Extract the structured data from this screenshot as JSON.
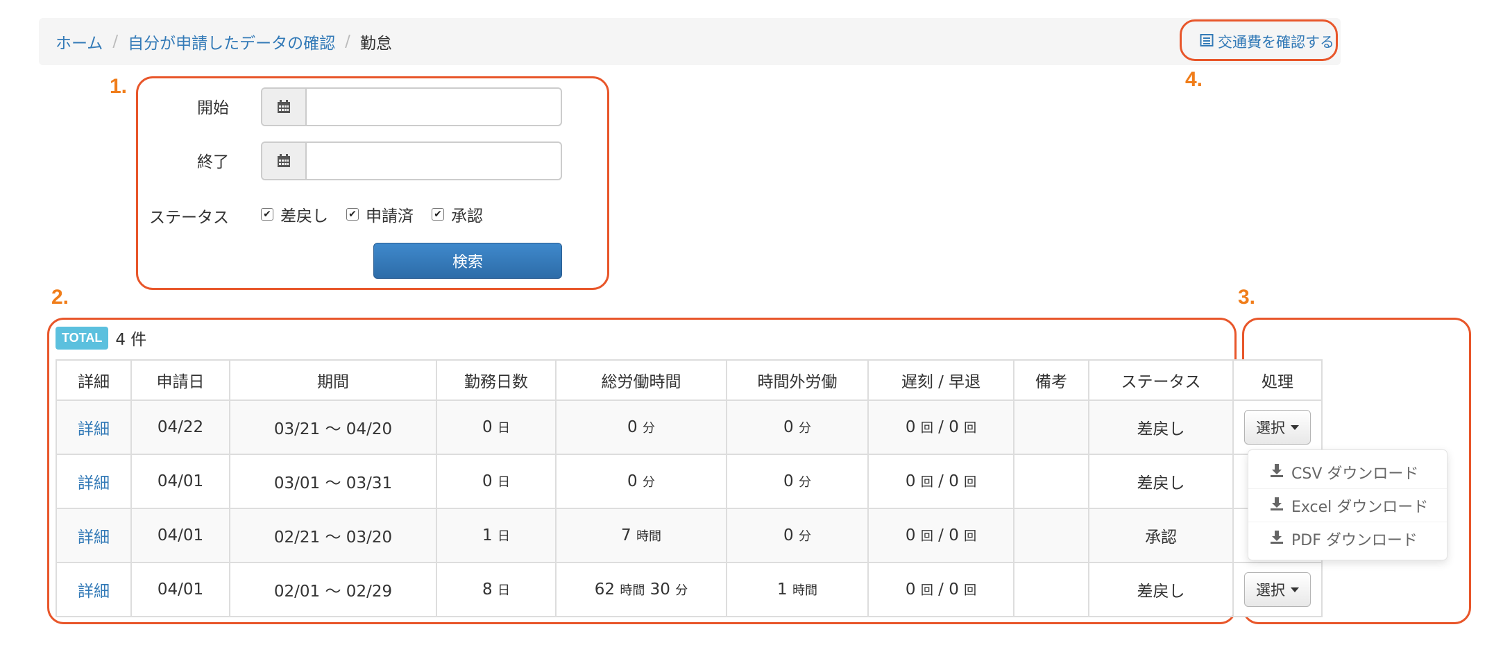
{
  "breadcrumb": {
    "home": "ホーム",
    "sep": "/",
    "requested": "自分が申請したデータの確認",
    "current": "勤怠"
  },
  "transport_link": {
    "label": "交通費を確認する",
    "icon": "list-icon"
  },
  "callouts": {
    "one": "1.",
    "two": "2.",
    "three": "3.",
    "four": "4."
  },
  "form": {
    "start_label": "開始",
    "end_label": "終了",
    "status_label": "ステータス",
    "start_value": "",
    "end_value": "",
    "statuses": [
      {
        "label": "差戻し",
        "checked": true
      },
      {
        "label": "申請済",
        "checked": true
      },
      {
        "label": "承認",
        "checked": true
      }
    ],
    "search_label": "検索"
  },
  "total": {
    "badge": "TOTAL",
    "count": "4 件"
  },
  "table": {
    "headers": [
      "詳細",
      "申請日",
      "期間",
      "勤務日数",
      "総労働時間",
      "時間外労働",
      "遅刻 / 早退",
      "備考",
      "ステータス",
      "処理"
    ],
    "rows": [
      {
        "detail": "詳細",
        "date": "04/22",
        "period": "03/21 〜 04/20",
        "days_n": "0",
        "days_u": "日",
        "total_a": "0",
        "total_au": "分",
        "total_b": "",
        "total_bu": "",
        "overtime_n": "0",
        "overtime_u": "分",
        "late": "0",
        "late_u": "回",
        "late_sep": "/",
        "early": "0",
        "early_u": "回",
        "note": "",
        "status": "差戻し",
        "action": "選択"
      },
      {
        "detail": "詳細",
        "date": "04/01",
        "period": "03/01 〜 03/31",
        "days_n": "0",
        "days_u": "日",
        "total_a": "0",
        "total_au": "分",
        "total_b": "",
        "total_bu": "",
        "overtime_n": "0",
        "overtime_u": "分",
        "late": "0",
        "late_u": "回",
        "late_sep": "/",
        "early": "0",
        "early_u": "回",
        "note": "",
        "status": "差戻し",
        "action": ""
      },
      {
        "detail": "詳細",
        "date": "04/01",
        "period": "02/21 〜 03/20",
        "days_n": "1",
        "days_u": "日",
        "total_a": "7",
        "total_au": "時間",
        "total_b": "",
        "total_bu": "",
        "overtime_n": "0",
        "overtime_u": "分",
        "late": "0",
        "late_u": "回",
        "late_sep": "/",
        "early": "0",
        "early_u": "回",
        "note": "",
        "status": "承認",
        "action": ""
      },
      {
        "detail": "詳細",
        "date": "04/01",
        "period": "02/01 〜 02/29",
        "days_n": "8",
        "days_u": "日",
        "total_a": "62",
        "total_au": "時間",
        "total_b": "30",
        "total_bu": "分",
        "overtime_n": "1",
        "overtime_u": "時間",
        "late": "0",
        "late_u": "回",
        "late_sep": "/",
        "early": "0",
        "early_u": "回",
        "note": "",
        "status": "差戻し",
        "action": "選択"
      }
    ]
  },
  "dropdown": {
    "items": [
      {
        "label": "CSV ダウンロード",
        "icon": "download-icon"
      },
      {
        "label": "Excel ダウンロード",
        "icon": "download-icon"
      },
      {
        "label": "PDF ダウンロード",
        "icon": "download-icon"
      }
    ]
  },
  "colors": {
    "accent": "#337ab7",
    "callout": "#e8562a",
    "callout_num": "#f07d1a",
    "badge": "#5bc0de",
    "primary": "#2d6ca8"
  }
}
